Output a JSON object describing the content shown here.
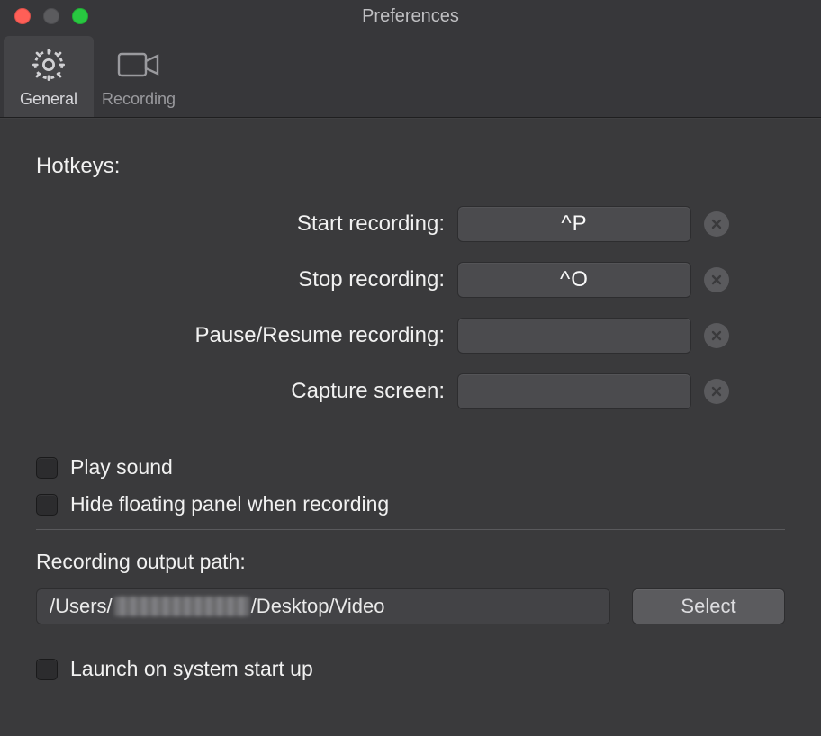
{
  "window": {
    "title": "Preferences"
  },
  "tabs": {
    "general": "General",
    "recording": "Recording"
  },
  "hotkeys": {
    "heading": "Hotkeys:",
    "start_label": "Start recording:",
    "start_value": "^P",
    "stop_label": "Stop recording:",
    "stop_value": "^O",
    "pause_label": "Pause/Resume recording:",
    "pause_value": "",
    "capture_label": "Capture screen:",
    "capture_value": ""
  },
  "options": {
    "play_sound_label": "Play sound",
    "play_sound_checked": false,
    "hide_panel_label": "Hide floating panel when recording",
    "hide_panel_checked": false,
    "launch_startup_label": "Launch on system start up",
    "launch_startup_checked": false
  },
  "output": {
    "label": "Recording output path:",
    "path_prefix": "/Users/",
    "path_suffix": "/Desktop/Video",
    "select_button": "Select"
  }
}
